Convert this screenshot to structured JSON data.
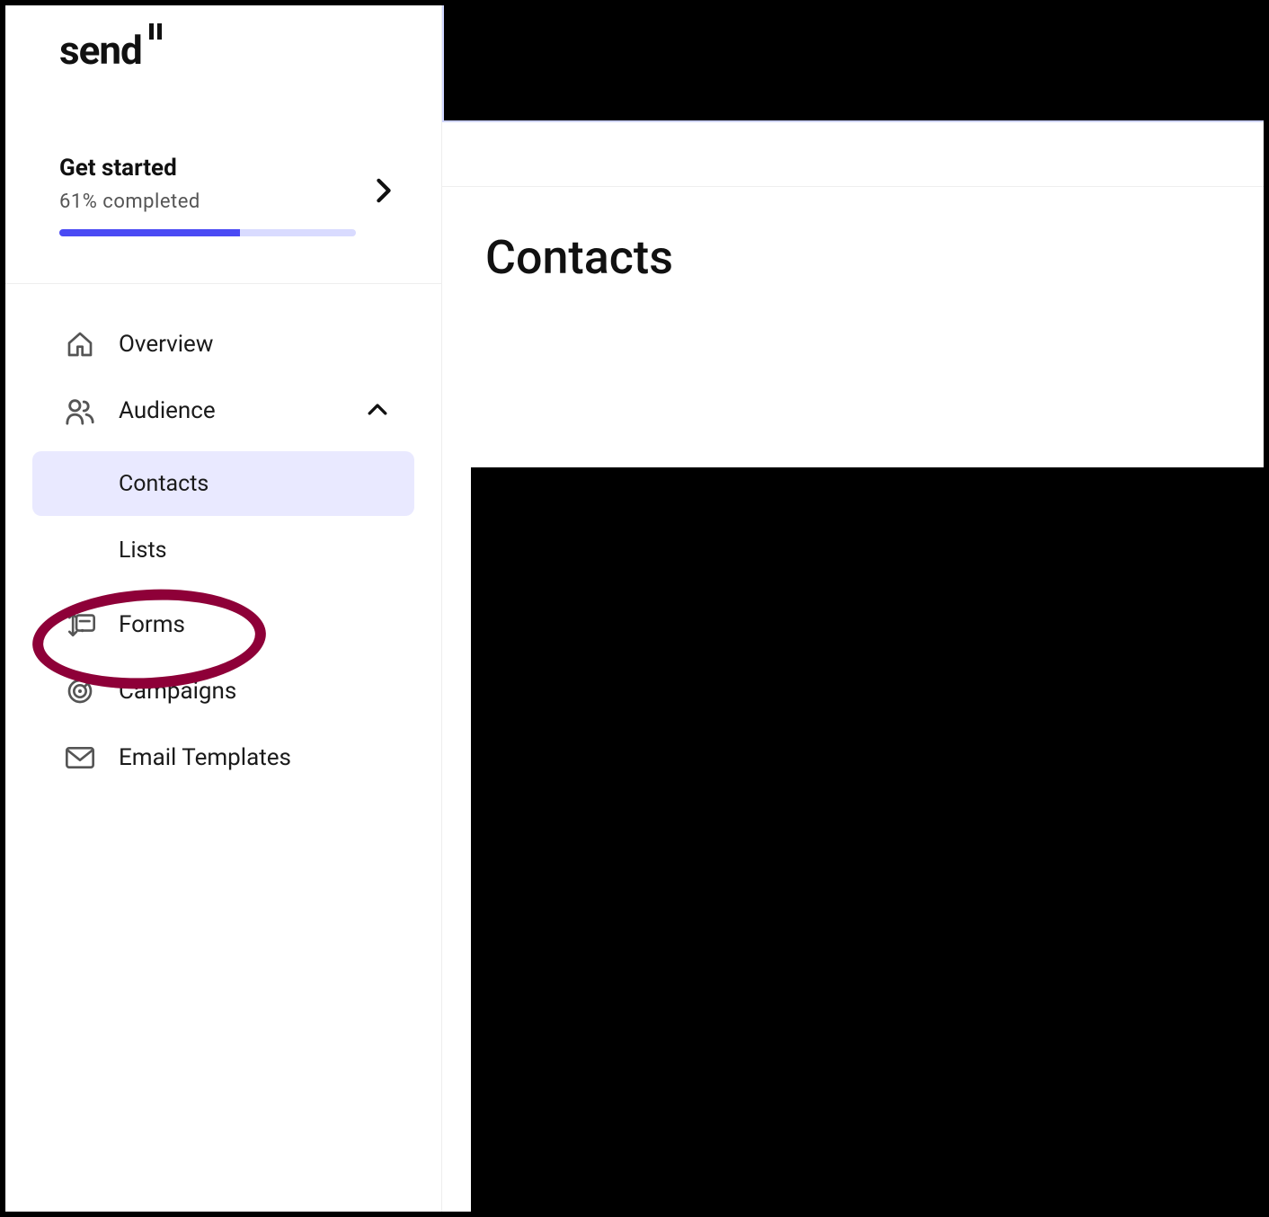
{
  "logo": {
    "text": "send"
  },
  "getStarted": {
    "title": "Get started",
    "subtitle": "61% completed",
    "progressPercent": 61
  },
  "nav": {
    "overview": "Overview",
    "audience": "Audience",
    "audience_items": {
      "contacts": "Contacts",
      "lists": "Lists"
    },
    "forms": "Forms",
    "campaigns": "Campaigns",
    "email_templates": "Email Templates"
  },
  "main": {
    "title": "Contacts"
  }
}
